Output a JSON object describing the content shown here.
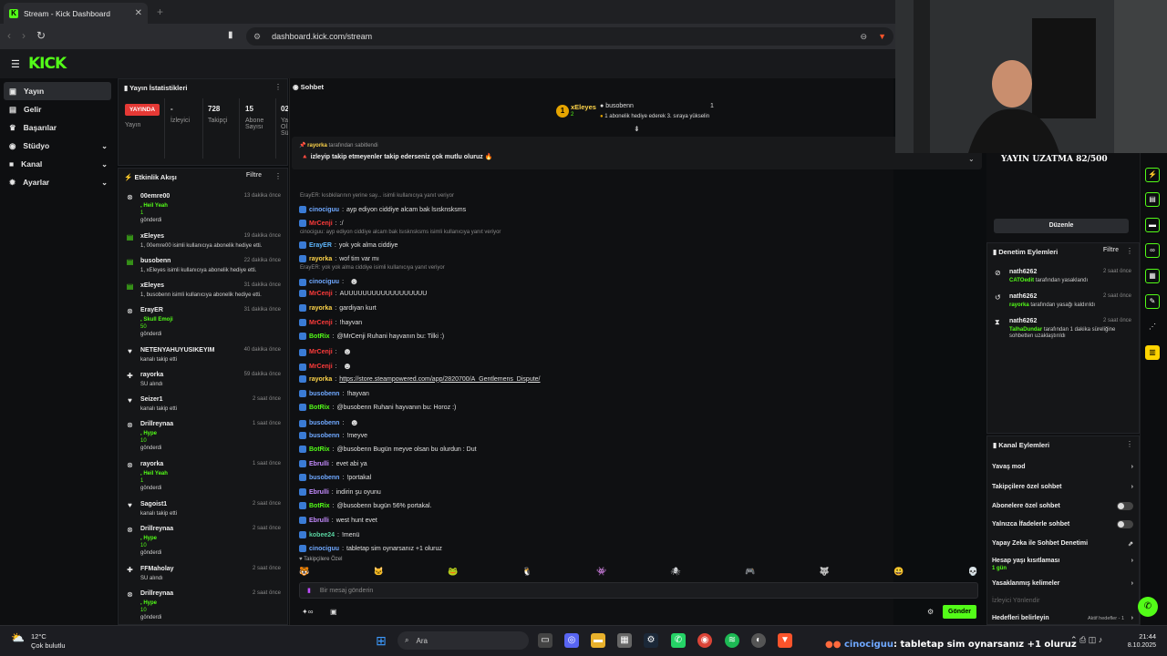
{
  "browser": {
    "tab_title": "Stream - Kick Dashboard",
    "url": "dashboard.kick.com/stream"
  },
  "header": {
    "logo": "KICK"
  },
  "sidebar": {
    "items": [
      {
        "label": "Yayın",
        "icon": "video-icon"
      },
      {
        "label": "Gelir",
        "icon": "money-icon"
      },
      {
        "label": "Başarılar",
        "icon": "trophy-icon"
      },
      {
        "label": "Stüdyo",
        "icon": "studio-icon"
      },
      {
        "label": "Kanal",
        "icon": "channel-icon"
      },
      {
        "label": "Ayarlar",
        "icon": "gear-icon"
      }
    ]
  },
  "stats": {
    "title": "Yayın İstatistikleri",
    "live_badge": "YAYINDA",
    "live_label": "Yayın",
    "viewers_value": "-",
    "viewers_label": "İzleyici",
    "followers_value": "728",
    "followers_label": "Takipçi",
    "subs_value": "15",
    "subs_label": "Abone Sayısı",
    "extra_value": "02",
    "extra_label": "Ya Ol Sü"
  },
  "activity": {
    "title": "Etkinlik Akışı",
    "filter": "Filtre",
    "items": [
      {
        "name": "00emre00",
        "time": "13 dakika önce",
        "line1": ", Heil Yeah",
        "line2": "1",
        "line3": "gönderdi"
      },
      {
        "name": "xEleyes",
        "time": "19 dakika önce",
        "line1": "1, 00emre00 isimli kullanıcıya abonelik hediye etti."
      },
      {
        "name": "busobenn",
        "time": "22 dakika önce",
        "line1": "1, xEleyes isimli kullanıcıya abonelik hediye etti."
      },
      {
        "name": "xEleyes",
        "time": "31 dakika önce",
        "line1": "1, busobenn isimli kullanıcıya abonelik hediye etti."
      },
      {
        "name": "ErayER",
        "time": "31 dakika önce",
        "line1": ", Skull Emoji",
        "line2": "50",
        "line3": "gönderdi"
      },
      {
        "name": "NETENYAHUYUSIKEYIM",
        "time": "40 dakika önce",
        "line1": "kanalı takip etti"
      },
      {
        "name": "rayorka",
        "time": "59 dakika önce",
        "line1": "SU alındı"
      },
      {
        "name": "Seizer1",
        "time": "2 saat önce",
        "line1": "kanalı takip etti"
      },
      {
        "name": "Drillreynaa",
        "time": "1 saat önce",
        "line1": ", Hype",
        "line2": "10",
        "line3": "gönderdi"
      },
      {
        "name": "rayorka",
        "time": "1 saat önce",
        "line1": ", Heil Yeah",
        "line2": "1",
        "line3": "gönderdi"
      },
      {
        "name": "Sagoist1",
        "time": "2 saat önce",
        "line1": "kanalı takip etti"
      },
      {
        "name": "Drillreynaa",
        "time": "2 saat önce",
        "line1": ", Hype",
        "line2": "10",
        "line3": "gönderdi"
      },
      {
        "name": "FFMaholay",
        "time": "2 saat önce",
        "line1": "SU alındı"
      },
      {
        "name": "Drillreynaa",
        "time": "2 saat önce",
        "line1": ", Hype",
        "line2": "10",
        "line3": "gönderdi"
      }
    ]
  },
  "chat": {
    "title": "Sohbet",
    "top_gifter": "xEleyes",
    "top_gifter_count": "2",
    "second_gifter": "busobenn",
    "second_gifter_count": "1",
    "gift_note": "1 abonelik hediye ederek 3. sıraya yükselin",
    "pinned_by": "rayorka",
    "pinned_by_suffix": "tarafından sabitlendi",
    "pinned_text": "izleyip takip etmeyenler takip ederseniz çok mutlu oluruz",
    "messages": [
      {
        "type": "reply",
        "text": "ErayER: kısbkilarının yerine say... isimli kullanıcıya yanıt veriyor"
      },
      {
        "user": "cinociguu",
        "color": "#6fa8ff",
        "text": "ayp ediyon ciddiye alcam bak lsısknsksms"
      },
      {
        "user": "MrCenji",
        "color": "#ff3b3b",
        "text": ":/"
      },
      {
        "type": "reply",
        "text": "cinociguu: ayp ediyon ciddiye alcam bak lsısknsksms isimli kullanıcıya yanıt veriyor"
      },
      {
        "user": "ErayER",
        "color": "#5fb8ff",
        "text": "yok yok alma ciddiye"
      },
      {
        "user": "rayorka",
        "color": "#ffd54a",
        "text": "wof tim var mı"
      },
      {
        "type": "reply",
        "text": "ErayER: yok yok alma ciddiye isimli kullanıcıya yanıt veriyor"
      },
      {
        "user": "cinociguu",
        "color": "#6fa8ff",
        "text": ""
      },
      {
        "user": "MrCenji",
        "color": "#ff3b3b",
        "text": "AUUUUUUUUUUUUUUUUUU"
      },
      {
        "user": "rayorka",
        "color": "#ffd54a",
        "text": "gardiyan kurt"
      },
      {
        "user": "MrCenji",
        "color": "#ff3b3b",
        "text": "!hayvan"
      },
      {
        "user": "BotRix",
        "color": "#53fc18",
        "text": "@MrCenji Ruhani hayvanın bu: Tilki :)"
      },
      {
        "user": "MrCenji",
        "color": "#ff3b3b",
        "text": ""
      },
      {
        "user": "MrCenji",
        "color": "#ff3b3b",
        "text": ""
      },
      {
        "user": "rayorka",
        "color": "#ffd54a",
        "text": "https://store.steampowered.com/app/2820700/A_Gentlemens_Dispute/"
      },
      {
        "user": "busobenn",
        "color": "#6fa8ff",
        "text": "!hayvan"
      },
      {
        "user": "BotRix",
        "color": "#53fc18",
        "text": "@busobenn Ruhani hayvanın bu: Horoz :)"
      },
      {
        "user": "busobenn",
        "color": "#6fa8ff",
        "text": ""
      },
      {
        "user": "busobenn",
        "color": "#6fa8ff",
        "text": "!meyve"
      },
      {
        "user": "BotRix",
        "color": "#53fc18",
        "text": "@busobenn Bugün meyve olsan bu olurdun : Dut"
      },
      {
        "user": "Ebrulli",
        "color": "#c58bff",
        "text": "evet abi ya"
      },
      {
        "user": "busobenn",
        "color": "#6fa8ff",
        "text": "!portakal"
      },
      {
        "user": "Ebrulli",
        "color": "#c58bff",
        "text": "indirin şu oyunu"
      },
      {
        "user": "BotRix",
        "color": "#53fc18",
        "text": "@busobenn bugün 56% portakal."
      },
      {
        "user": "Ebrulli",
        "color": "#c58bff",
        "text": "west hunt evet"
      },
      {
        "user": "kobee24",
        "color": "#59d3a0",
        "text": "!menü"
      },
      {
        "user": "cinociguu",
        "color": "#6fa8ff",
        "text": "tabletap sim oynarsanız +1 oluruz"
      }
    ],
    "emote_section": "Takipçilere Özel",
    "input_placeholder": "Bir mesaj gönderin",
    "send_label": "Gönder"
  },
  "right": {
    "webcam_overlay": "YAYIN UZATMA 82/500",
    "edit_button": "Düzenle",
    "mod_title": "Denetim Eylemleri",
    "mod_filter": "Filtre",
    "mod_items": [
      {
        "name": "nath6262",
        "time": "2 saat önce",
        "target": "CATOedit",
        "text": "tarafından yasaklandı"
      },
      {
        "name": "nath6262",
        "time": "2 saat önce",
        "target": "rayorka",
        "text": "tarafından yasağı kaldırıldı"
      },
      {
        "name": "nath6262",
        "time": "2 saat önce",
        "target": "TalhaDundar",
        "text": "tarafından 1 dakika süreliğine sohbetten uzaklaştırıldı"
      }
    ],
    "channel_title": "Kanal Eylemleri",
    "options": [
      {
        "label": "Yavaş mod",
        "kind": "arrow"
      },
      {
        "label": "Takipçilere özel sohbet",
        "kind": "arrow"
      },
      {
        "label": "Abonelere özel sohbet",
        "kind": "toggle"
      },
      {
        "label": "Yalnızca İfadelerle sohbet",
        "kind": "toggle"
      },
      {
        "label": "Yapay Zeka ile Sohbet Denetimi",
        "kind": "external"
      },
      {
        "label": "Hesap yaşı kısıtlaması",
        "kind": "arrow",
        "sub": "1 gün"
      },
      {
        "label": "Yasaklanmış kelimeler",
        "kind": "arrow"
      },
      {
        "label": "İzleyici Yönlendir",
        "kind": "none"
      },
      {
        "label": "Hedefleri belirleyin",
        "kind": "arrow",
        "sub2": "Aktif hedefler - 1"
      }
    ]
  },
  "taskbar": {
    "weather_temp": "12°C",
    "weather_desc": "Çok bulutlu",
    "search": "Ara",
    "ticker_user": "cinociguu",
    "ticker_text": ": tabletap sim oynarsanız +1 oluruz",
    "time": "21:44",
    "date": "8.10.2025"
  },
  "colors": {
    "accent": "#53fc18",
    "live": "#e53935",
    "bg": "#0b0d0f"
  }
}
